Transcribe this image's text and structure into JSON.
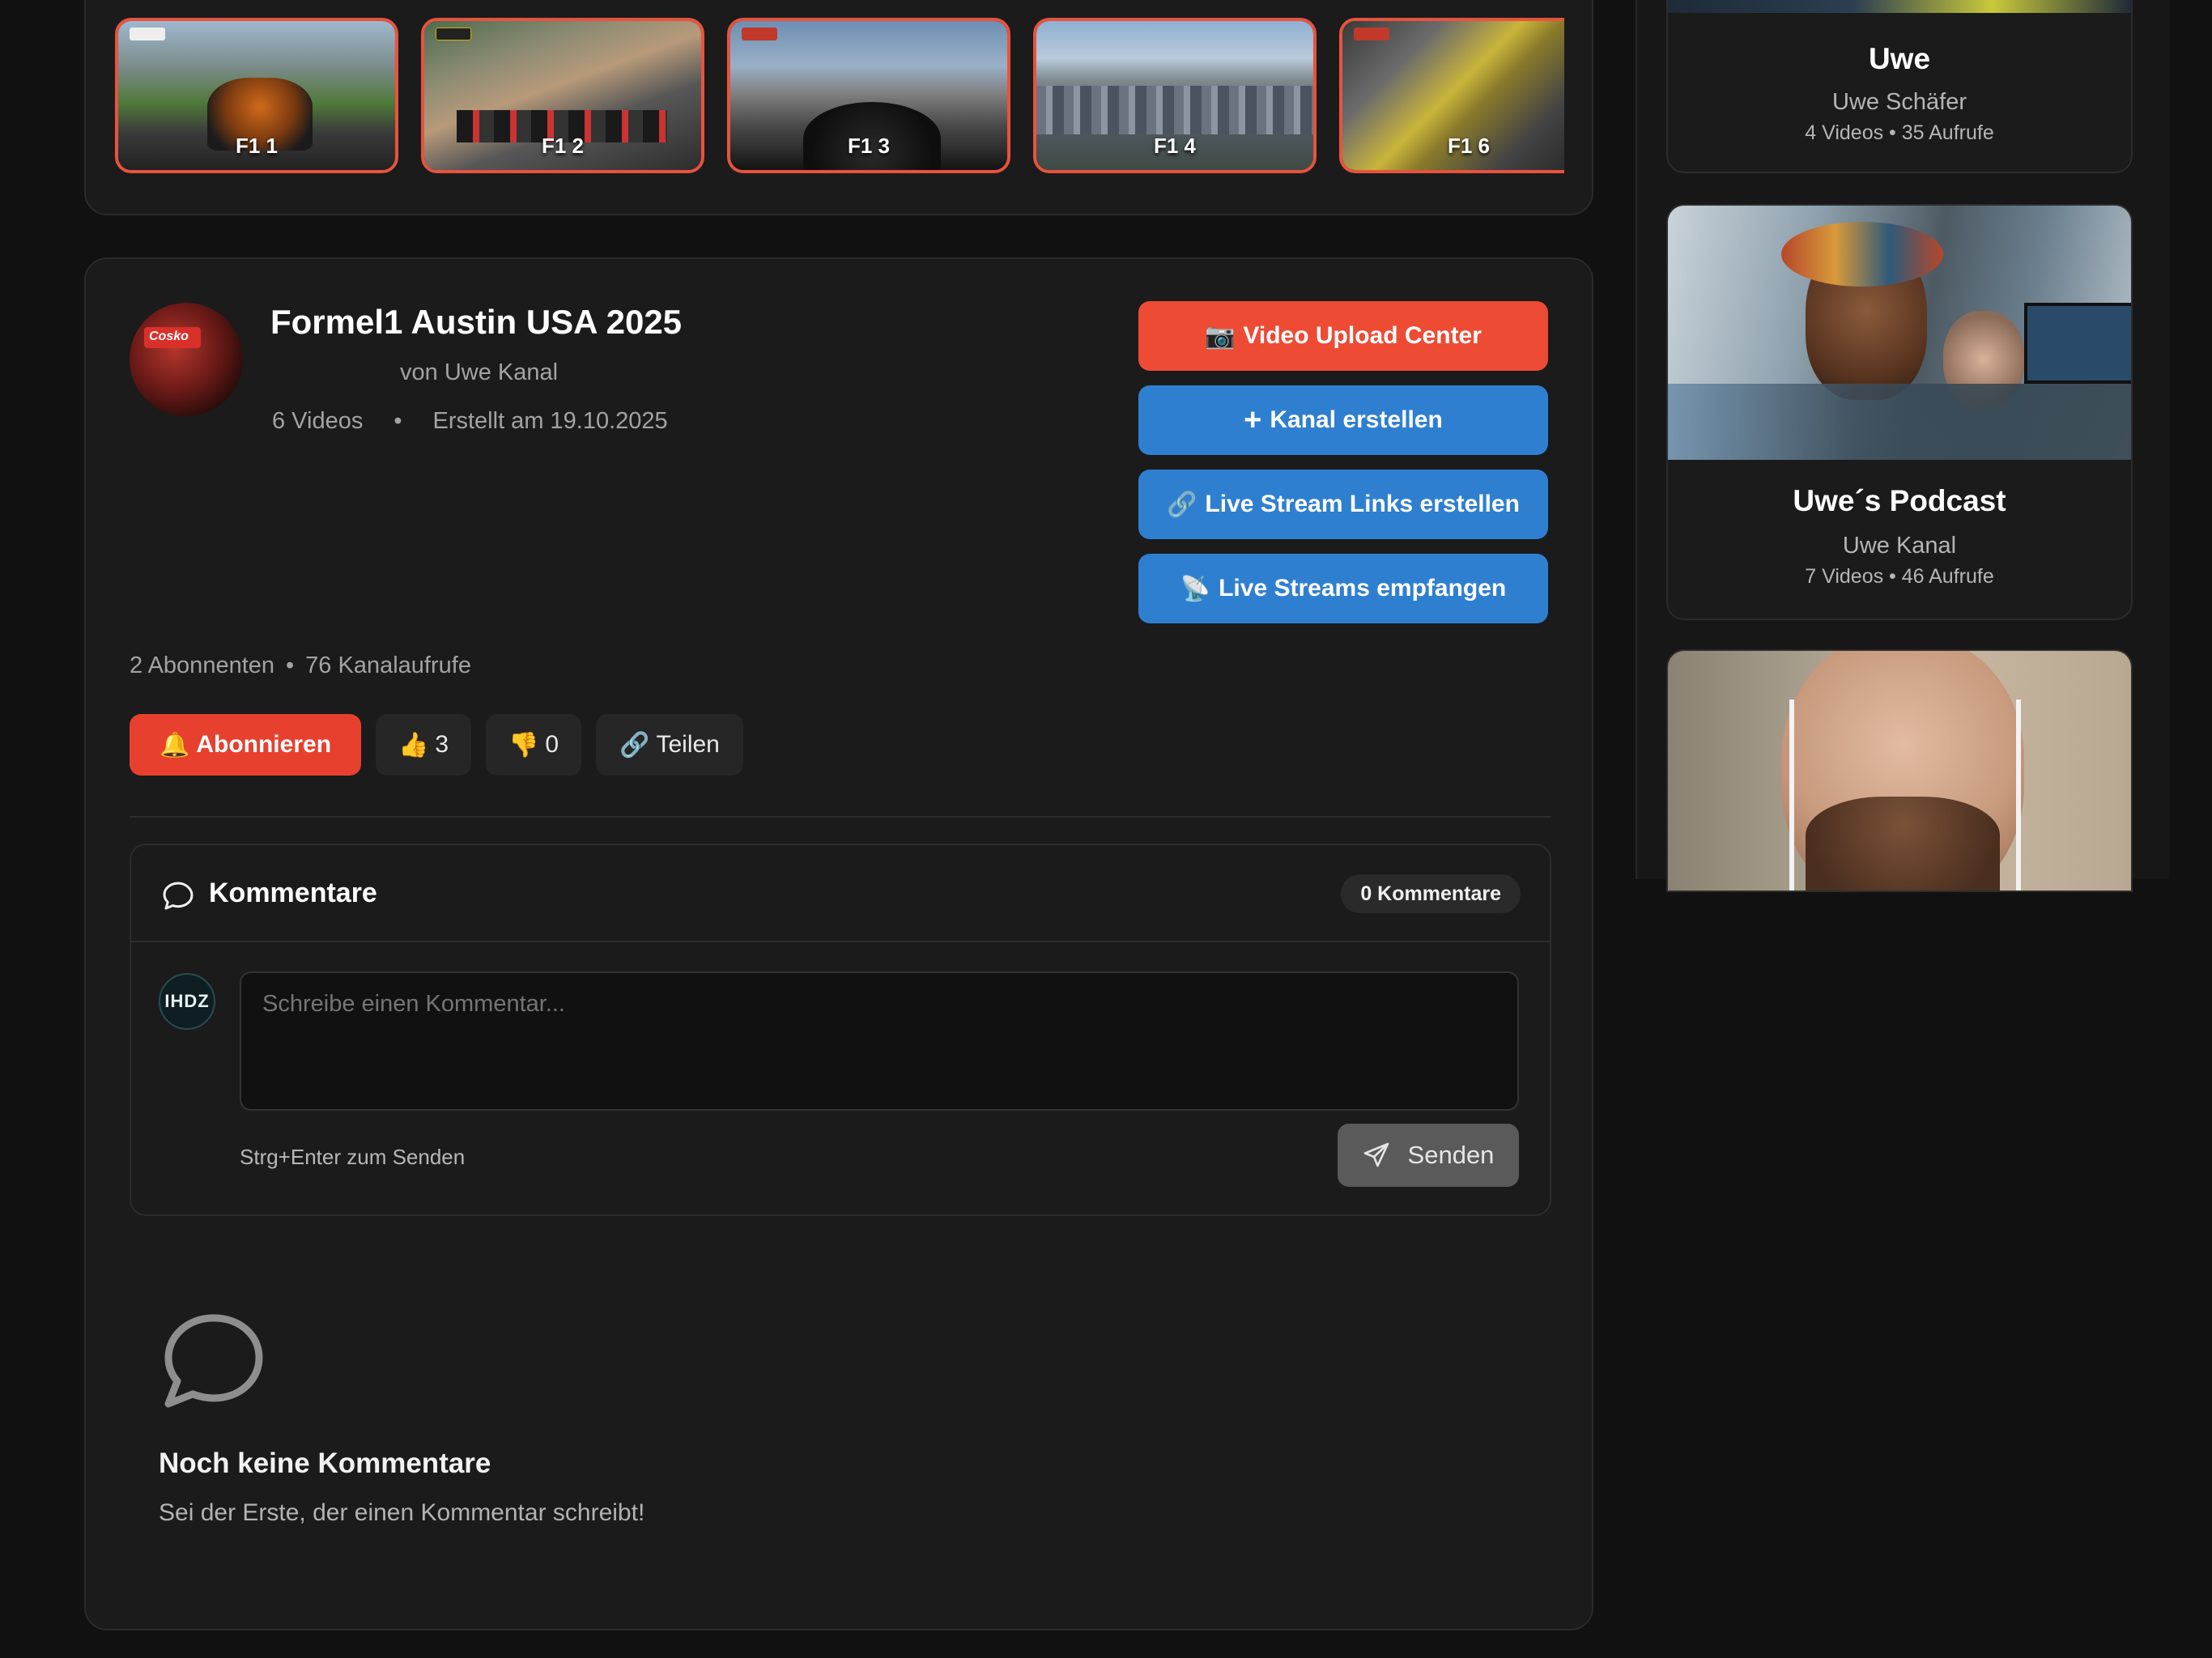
{
  "thumbnails": [
    {
      "label": "F1 1"
    },
    {
      "label": "F1 2"
    },
    {
      "label": "F1 3"
    },
    {
      "label": "F1 4"
    },
    {
      "label": "F1 6"
    }
  ],
  "playlist": {
    "title": "Formel1 Austin USA 2025",
    "byline": "von Uwe Kanal",
    "video_count": "6 Videos",
    "separator": "•",
    "created": "Erstellt am 19.10.2025",
    "avatar_sign": "Cosko"
  },
  "actions": {
    "upload_icon": "📷",
    "upload": "Video Upload Center",
    "create_channel_icon": "+",
    "create_channel": "Kanal erstellen",
    "live_links_icon": "🔗",
    "live_links": "Live Stream Links erstellen",
    "live_receive_icon": "📡",
    "live_receive": "Live Streams empfangen"
  },
  "channel_stats": {
    "subscribers": "2 Abonnenten",
    "separator": "•",
    "views": "76 Kanalaufrufe"
  },
  "engagement": {
    "subscribe_icon": "🔔",
    "subscribe": "Abonnieren",
    "like_icon": "👍",
    "likes": "3",
    "dislike_icon": "👎",
    "dislikes": "0",
    "share_icon": "🔗",
    "share": "Teilen"
  },
  "comments": {
    "title": "Kommentare",
    "count_badge": "0 Kommentare",
    "user_avatar": "IHDZ",
    "placeholder": "Schreibe einen Kommentar...",
    "hint": "Strg+Enter zum Senden",
    "send": "Senden",
    "empty_title": "Noch keine Kommentare",
    "empty_subtitle": "Sei der Erste, der einen Kommentar schreibt!"
  },
  "sidebar": {
    "cards": [
      {
        "name": "Uwe",
        "owner": "Uwe Schäfer",
        "meta": "4 Videos • 35 Aufrufe"
      },
      {
        "name": "Uwe´s Podcast",
        "owner": "Uwe Kanal",
        "meta": "7 Videos • 46 Aufrufe"
      }
    ]
  },
  "colors": {
    "accent_red": "#ee4b35",
    "accent_blue": "#2f7fd1",
    "background": "#111111",
    "card": "#1b1b1b"
  }
}
